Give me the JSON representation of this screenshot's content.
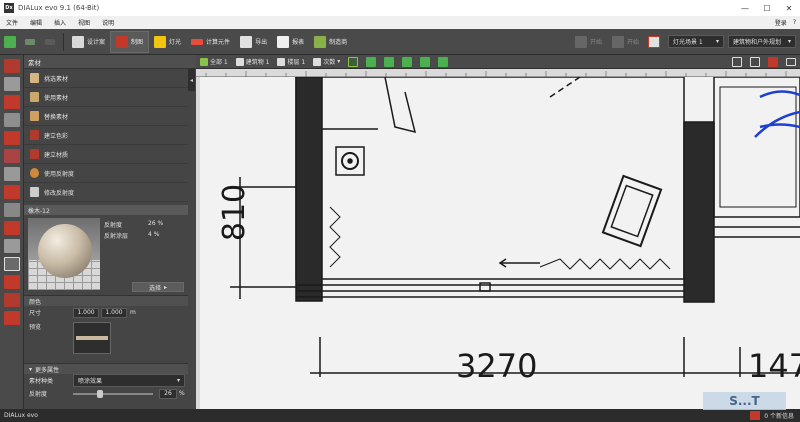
{
  "window": {
    "title": "DIALux evo 9.1  (64-Bit)",
    "app_icon": "Dx",
    "min": "—",
    "max": "☐",
    "close": "✕"
  },
  "menu": {
    "items": [
      "文件",
      "编辑",
      "插入",
      "视图",
      "说明"
    ],
    "login": "登录",
    "help": "?"
  },
  "toolbar": {
    "design": "设计案",
    "build": "制图",
    "light": "灯光",
    "calc": "计算元件",
    "export": "导出",
    "report": "报表",
    "draw": "制造商",
    "disabled1": "开始",
    "disabled2": "开始",
    "scene": "灯光场景 1",
    "planning": "建筑物和户外规划"
  },
  "view_toolbar": {
    "all": "全部 1",
    "building": "建筑物 1",
    "floor": "楼层 1",
    "level": "次数"
  },
  "panel": {
    "title": "素材",
    "collapse": "◂",
    "tools": [
      "挑选素材",
      "使用素材",
      "替换素材",
      "建立色彩",
      "建立材质",
      "使用反射度",
      "修改反射度"
    ],
    "material_name": "橡木-12",
    "reflectance_label": "反射度",
    "reflectance_value": "26 %",
    "transmission_label": "反射涂层",
    "transmission_value": "4 %",
    "choose": "选择",
    "choose_arrow": "▸",
    "color_section": "颜色",
    "size_label": "尺寸",
    "size_w": "1.000",
    "size_h": "1.000",
    "size_unit": "m",
    "preview_label": "预览",
    "more_props": "更多属性",
    "more_props_arrow": "▾",
    "material_type_label": "素材种类",
    "material_type_value": "喷涂效果",
    "reflect_label": "反射度",
    "reflect_value": "26",
    "reflect_unit": "%"
  },
  "status": {
    "app": "DIALux evo",
    "messages": "0 个新信息"
  },
  "drawing": {
    "dim1": "810",
    "dim2": "3270",
    "dim3": "147"
  },
  "watermark": "S...T"
}
